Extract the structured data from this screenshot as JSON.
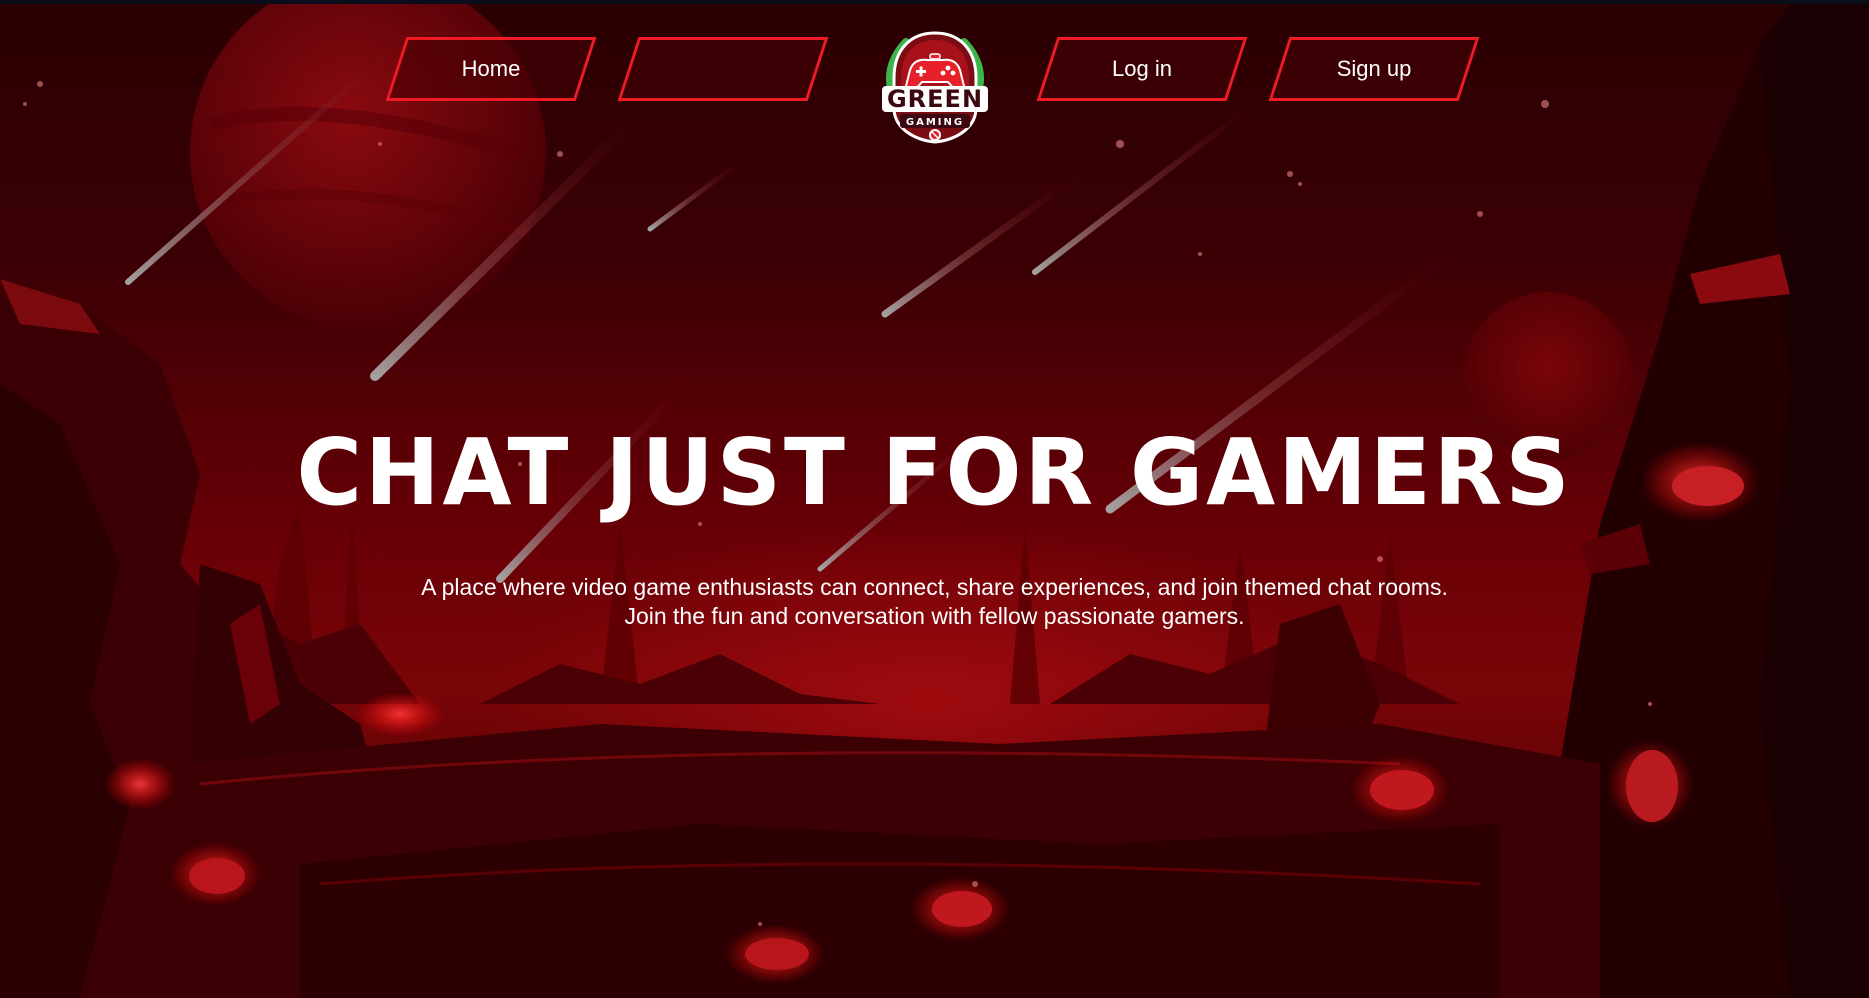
{
  "nav": {
    "home_label": "Home",
    "blank_label": "",
    "login_label": "Log in",
    "signup_label": "Sign up"
  },
  "logo": {
    "line1": "GREEN",
    "line2": "GAMING",
    "icon": "gamepad-icon"
  },
  "hero": {
    "title": "CHAT JUST FOR GAMERS",
    "subtitle": "A place where video game enthusiasts can connect, share experiences, and join themed chat rooms. Join the fun and conversation with fellow passionate gamers."
  },
  "colors": {
    "accent": "#ee1b24",
    "background_dark": "#2a0003",
    "background_mid": "#6a0006",
    "logo_green": "#3cb44a"
  }
}
